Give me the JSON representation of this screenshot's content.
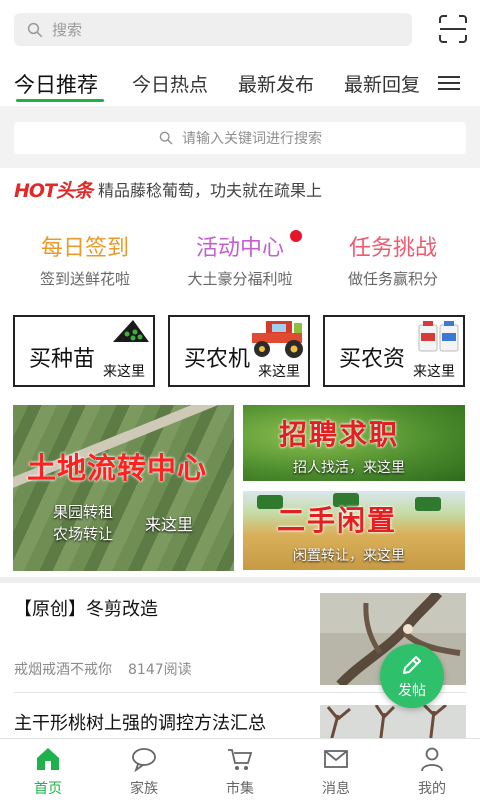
{
  "search": {
    "placeholder": "搜索"
  },
  "tabs": [
    {
      "label": "今日推荐",
      "active": true
    },
    {
      "label": "今日热点"
    },
    {
      "label": "最新发布"
    },
    {
      "label": "最新回复"
    }
  ],
  "keyword_search": {
    "placeholder": "请输入关键词进行搜索"
  },
  "hot": {
    "tag": "HOT头条",
    "text": "精品藤稔葡萄，功夫就在疏果上"
  },
  "features": [
    {
      "title": "每日签到",
      "subtitle": "签到送鲜花啦",
      "color": "#e89a2a"
    },
    {
      "title": "活动中心",
      "subtitle": "大土豪分福利啦",
      "color": "#c35fd1"
    },
    {
      "title": "任务挑战",
      "subtitle": "做任务赢积分",
      "color": "#ef5a6e"
    }
  ],
  "buy_cards": [
    {
      "title": "买种苗",
      "sub": "来这里"
    },
    {
      "title": "买农机",
      "sub": "来这里"
    },
    {
      "title": "买农资",
      "sub": "来这里"
    }
  ],
  "banners": {
    "land": {
      "title": "土地流转中心",
      "line1": "果园转租",
      "line2": "农场转让",
      "cta": "来这里"
    },
    "job": {
      "title": "招聘求职",
      "sub": "招人找活，来这里"
    },
    "used": {
      "title": "二手闲置",
      "sub": "闲置转让，来这里"
    }
  },
  "articles": [
    {
      "title": "【原创】冬剪改造",
      "author": "戒烟戒酒不戒你",
      "reads": "8147阅读"
    },
    {
      "title": "主干形桃树上强的调控方法汇总"
    }
  ],
  "fab": {
    "label": "发帖"
  },
  "bottom_nav": [
    {
      "label": "首页",
      "icon": "home-icon",
      "active": true
    },
    {
      "label": "家族",
      "icon": "chat-icon"
    },
    {
      "label": "市集",
      "icon": "cart-icon"
    },
    {
      "label": "消息",
      "icon": "mail-icon"
    },
    {
      "label": "我的",
      "icon": "user-icon"
    }
  ],
  "colors": {
    "accent": "#1fb14b",
    "hot": "#e02a2a",
    "fab": "#2ec06a"
  }
}
